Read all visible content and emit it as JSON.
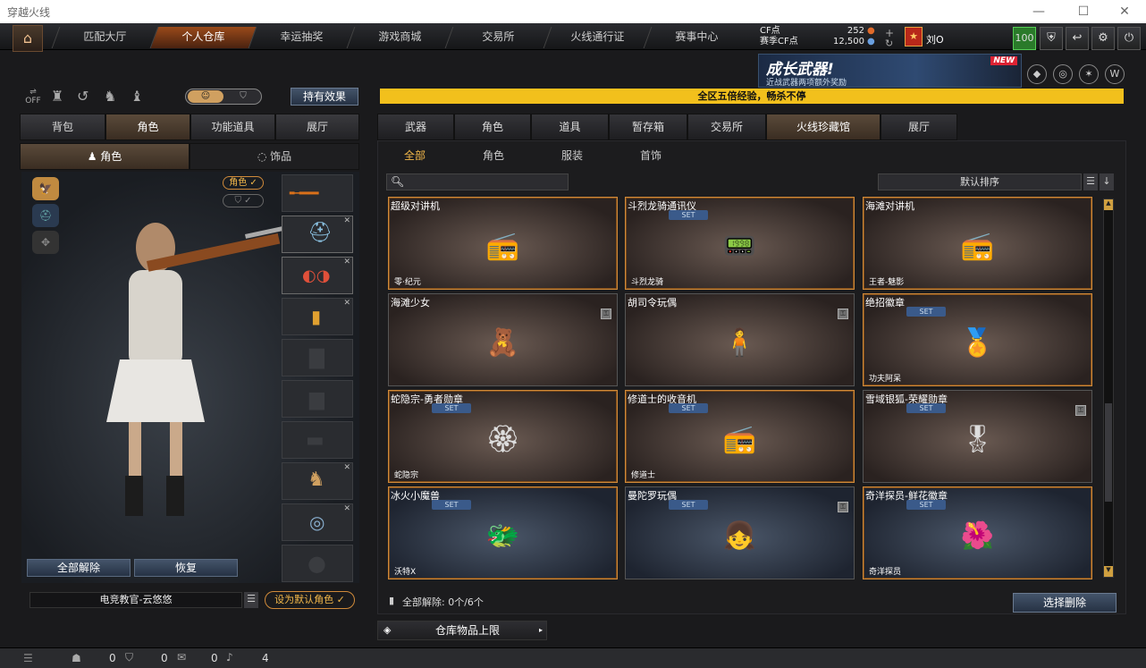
{
  "window": {
    "title": "穿越火线"
  },
  "nav": {
    "tabs": [
      "匹配大厅",
      "个人仓库",
      "幸运抽奖",
      "游戏商城",
      "交易所",
      "火线通行证",
      "赛事中心"
    ],
    "active_index": 1
  },
  "currency": {
    "cf_label": "CF点",
    "cf_value": "252",
    "season_label": "赛季CF点",
    "season_value": "12,500"
  },
  "user": {
    "name": "刘O",
    "level_badge": "100"
  },
  "banner": {
    "title": "成长武器!",
    "subtitle": "近战武器两项额外奖励",
    "badge": "NEW"
  },
  "announcement": "全区五倍经验，畅杀不停",
  "left_panel": {
    "effects_button": "持有效果",
    "tabs": [
      "背包",
      "角色",
      "功能道具",
      "展厅"
    ],
    "active_tab": 1,
    "subtabs": [
      "角色",
      "饰品"
    ],
    "role_filter": "角色",
    "unequip_all": "全部解除",
    "restore": "恢复",
    "character_name": "电竞教官-云悠悠",
    "set_default": "设为默认角色"
  },
  "right_panel": {
    "tabs": [
      "武器",
      "角色",
      "道具",
      "暂存箱",
      "交易所",
      "火线珍藏馆",
      "展厅"
    ],
    "active_tab": 5,
    "categories": [
      "全部",
      "角色",
      "服装",
      "首饰"
    ],
    "active_category": 0,
    "sort_label": "默认排序",
    "search_placeholder": "",
    "items": [
      {
        "name": "超级对讲机",
        "owner": "零·纪元",
        "set": false,
        "locked": false,
        "style": "gold"
      },
      {
        "name": "斗烈龙骑通讯仪",
        "owner": "斗烈龙骑",
        "set": true,
        "locked": false,
        "style": "gold"
      },
      {
        "name": "海滩对讲机",
        "owner": "王者-魅影",
        "set": false,
        "locked": false,
        "style": "gold"
      },
      {
        "name": "海滩少女",
        "owner": "",
        "set": false,
        "locked": true,
        "style": "plain"
      },
      {
        "name": "胡司令玩偶",
        "owner": "",
        "set": false,
        "locked": true,
        "style": "plain"
      },
      {
        "name": "绝招徽章",
        "owner": "功夫阿呆",
        "set": true,
        "locked": false,
        "style": "gold"
      },
      {
        "name": "蛇隐宗-勇者勋章",
        "owner": "蛇隐宗",
        "set": true,
        "locked": false,
        "style": "gold"
      },
      {
        "name": "修道士的收音机",
        "owner": "修道士",
        "set": true,
        "locked": false,
        "style": "gold"
      },
      {
        "name": "雪域银狐-荣耀勋章",
        "owner": "",
        "set": true,
        "locked": true,
        "style": "plain"
      },
      {
        "name": "冰火小魔兽",
        "owner": "沃特X",
        "set": true,
        "locked": false,
        "style": "gold-blue"
      },
      {
        "name": "曼陀罗玩偶",
        "owner": "",
        "set": true,
        "locked": true,
        "style": "blue"
      },
      {
        "name": "奇洋探员-鲜花徽章",
        "owner": "奇洋探员",
        "set": true,
        "locked": false,
        "style": "gold-blue"
      }
    ],
    "unequip_count": "全部解除: 0个/6个",
    "select_delete": "选择删除",
    "storage_limit": "仓库物品上限"
  },
  "statusbar": {
    "v1": "0",
    "v2": "0",
    "v3": "0",
    "v4": "4"
  },
  "colors": {
    "accent": "#f3b84a",
    "announcement_bg": "#f2c01c"
  }
}
